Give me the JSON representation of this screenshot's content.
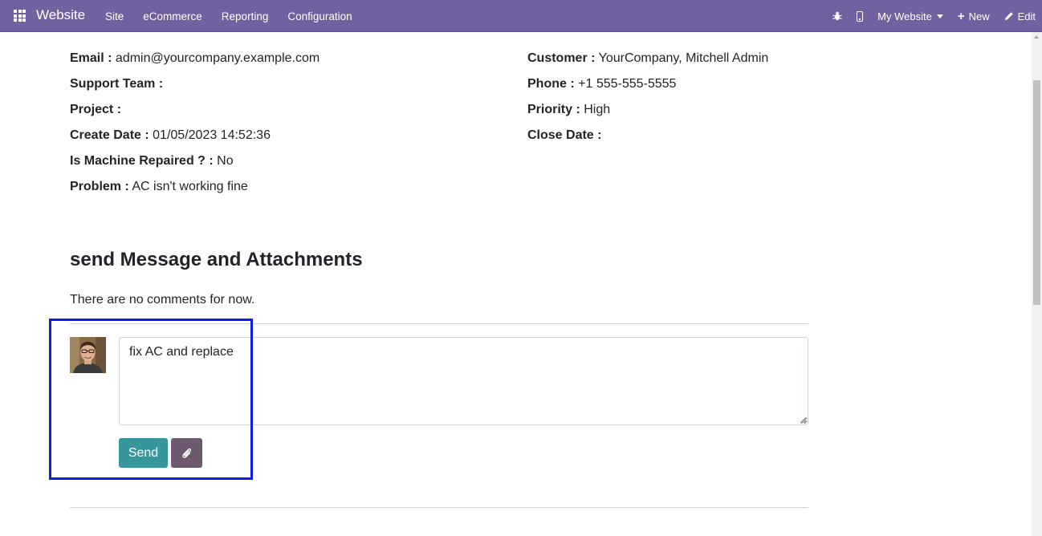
{
  "navbar": {
    "app_name": "Website",
    "menu": [
      "Site",
      "eCommerce",
      "Reporting",
      "Configuration"
    ],
    "website_selector": "My Website",
    "new_label": "New",
    "edit_label": "Edit",
    "color": "#7161a0"
  },
  "ticket": {
    "email": {
      "label": "Email :",
      "value": "admin@yourcompany.example.com"
    },
    "support_team": {
      "label": "Support Team :",
      "value": ""
    },
    "project": {
      "label": "Project :",
      "value": ""
    },
    "create_date": {
      "label": "Create Date :",
      "value": "01/05/2023 14:52:36"
    },
    "machine_repaired": {
      "label": "Is Machine Repaired ? :",
      "value": "No"
    },
    "problem": {
      "label": "Problem :",
      "value": "AC isn't working fine"
    },
    "customer": {
      "label": "Customer :",
      "value": "YourCompany, Mitchell Admin"
    },
    "phone": {
      "label": "Phone :",
      "value": "+1 555-555-5555"
    },
    "priority": {
      "label": "Priority :",
      "value": "High"
    },
    "close_date": {
      "label": "Close Date :",
      "value": ""
    }
  },
  "messages": {
    "title": "send Message and Attachments",
    "empty_text": "There are no comments for now.",
    "composer_value": "fix AC and replace",
    "send_label": "Send",
    "send_color": "#35979c",
    "attach_color": "#6e5a6e"
  }
}
